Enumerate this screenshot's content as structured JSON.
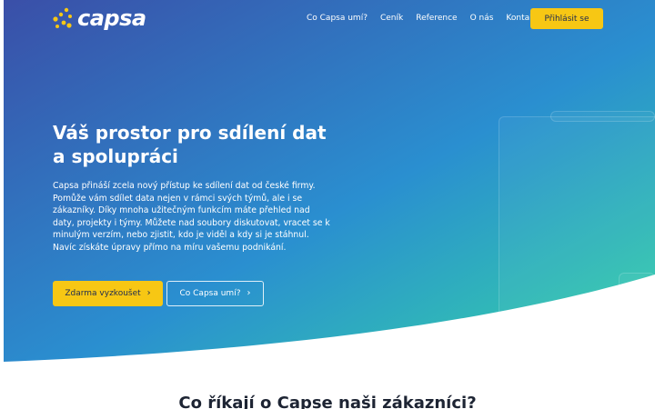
{
  "brand": {
    "name": "capsa",
    "logo_icon": "dots-logo-icon",
    "accent_color": "#f7c714",
    "dot_color": "#f7c714"
  },
  "nav": {
    "items": [
      {
        "label": "Co Capsa umí?"
      },
      {
        "label": "Ceník"
      },
      {
        "label": "Reference"
      },
      {
        "label": "O nás"
      },
      {
        "label": "Kontakt"
      }
    ],
    "login_label": "Přihlásit se"
  },
  "hero": {
    "headline": "Váš prostor pro sdílení dat a spolupráci",
    "description": "Capsa přináší zcela nový přístup ke sdílení dat od české firmy. Pomůže vám sdílet data nejen v rámci svých týmů, ale i se zákazníky. Díky mnoha užitečným funkcím máte přehled nad daty, projekty i týmy. Můžete nad soubory diskutovat, vracet se k minulým verzím, nebo zjistit, kdo je viděl a kdy si je stáhnul. Navíc získáte úpravy přímo na míru vašemu podnikání.",
    "primary_cta": "Zdarma vyzkoušet",
    "secondary_cta": "Co Capsa umí?",
    "gradient": {
      "start": "#3a4fa8",
      "middle": "#2a8fd0",
      "end": "#35d6a6"
    }
  },
  "testimonials": {
    "title": "Co říkají o Capse naši zákazníci?"
  }
}
